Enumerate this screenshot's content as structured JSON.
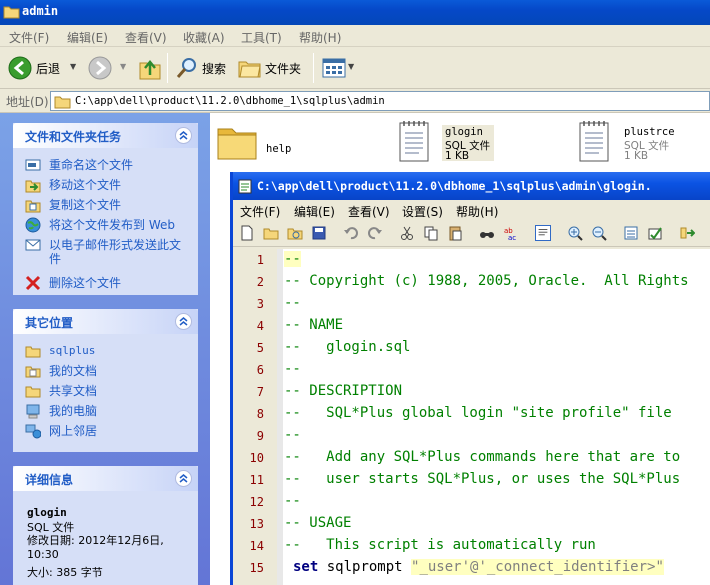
{
  "window": {
    "title": "admin"
  },
  "menubar": {
    "items": [
      "文件(F)",
      "编辑(E)",
      "查看(V)",
      "收藏(A)",
      "工具(T)",
      "帮助(H)"
    ]
  },
  "toolbar": {
    "back_label": "后退",
    "search_label": "搜索",
    "folders_label": "文件夹"
  },
  "address": {
    "label": "地址(D)",
    "path": "C:\\app\\dell\\product\\11.2.0\\dbhome_1\\sqlplus\\admin"
  },
  "taskpane": {
    "file_tasks": {
      "title": "文件和文件夹任务",
      "items": [
        {
          "label": "重命名这个文件",
          "icon": "rename-icon"
        },
        {
          "label": "移动这个文件",
          "icon": "move-icon"
        },
        {
          "label": "复制这个文件",
          "icon": "copy-icon"
        },
        {
          "label": "将这个文件发布到 Web",
          "icon": "publish-web-icon"
        },
        {
          "label": "以电子邮件形式发送此文件",
          "icon": "email-icon"
        },
        {
          "label": "删除这个文件",
          "icon": "delete-icon"
        }
      ]
    },
    "other_places": {
      "title": "其它位置",
      "items": [
        {
          "label": "sqlplus",
          "icon": "folder-icon"
        },
        {
          "label": "我的文档",
          "icon": "my-documents-icon"
        },
        {
          "label": "共享文档",
          "icon": "shared-documents-icon"
        },
        {
          "label": "我的电脑",
          "icon": "my-computer-icon"
        },
        {
          "label": "网上邻居",
          "icon": "network-places-icon"
        }
      ]
    },
    "details": {
      "title": "详细信息",
      "name": "glogin",
      "type": "SQL 文件",
      "modified": "修改日期: 2012年12月6日, 10:30",
      "size": "大小: 385 字节"
    }
  },
  "files": [
    {
      "name": "help",
      "type": "",
      "size": ""
    },
    {
      "name": "glogin",
      "type": "SQL 文件",
      "size": "1 KB"
    },
    {
      "name": "plustrce",
      "type": "SQL 文件",
      "size": "1 KB"
    }
  ],
  "editor": {
    "title": "C:\\app\\dell\\product\\11.2.0\\dbhome_1\\sqlplus\\admin\\glogin.",
    "menu": [
      "文件(F)",
      "编辑(E)",
      "查看(V)",
      "设置(S)",
      "帮助(H)"
    ],
    "lines": [
      {
        "n": "1",
        "text": "--"
      },
      {
        "n": "2",
        "text": "-- Copyright (c) 1988, 2005, Oracle.  All Rights"
      },
      {
        "n": "3",
        "text": "--"
      },
      {
        "n": "4",
        "text": "-- NAME"
      },
      {
        "n": "5",
        "text": "--   glogin.sql"
      },
      {
        "n": "6",
        "text": "--"
      },
      {
        "n": "7",
        "text": "-- DESCRIPTION"
      },
      {
        "n": "8",
        "text": "--   SQL*Plus global login \"site profile\" file"
      },
      {
        "n": "9",
        "text": "--"
      },
      {
        "n": "10",
        "text": "--   Add any SQL*Plus commands here that are to"
      },
      {
        "n": "11",
        "text": "--   user starts SQL*Plus, or uses the SQL*Plus"
      },
      {
        "n": "12",
        "text": "--"
      },
      {
        "n": "13",
        "text": "-- USAGE"
      },
      {
        "n": "14",
        "text": "--   This script is automatically run"
      }
    ],
    "last_line": {
      "n": "15",
      "keyword": "set",
      "command": " sqlprompt ",
      "value": "\"_user'@'_connect_identifier>\""
    }
  }
}
